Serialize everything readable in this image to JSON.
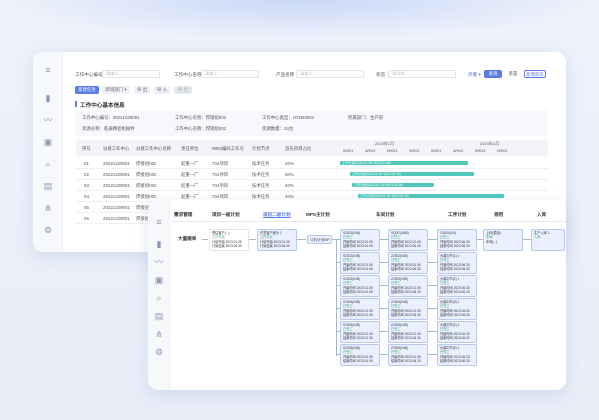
{
  "filters": {
    "wc_code_label": "工作中心编号",
    "wc_code_placeholder": "请输入",
    "wc_name_label": "工作中心名称",
    "wc_name_placeholder": "请输入",
    "product_name_label": "产品名称",
    "product_name_placeholder": "请输入",
    "status_label": "状态",
    "status_placeholder": "请选择",
    "expand_label": "折叠 ▾",
    "query_label": "查询",
    "reset_label": "重置",
    "new_label": "新增库房"
  },
  "toolbar": {
    "btn1": "新建任务",
    "btn2": "新增部门  ▾",
    "btn3": "导 出",
    "btn4": "导 入",
    "btn5": "导 出"
  },
  "basic": {
    "title": "工作中心基本信息",
    "fields": [
      "工作中心编号：20221229001",
      "工作中心名称：焊接组002",
      "工作中心类型：HYD60001",
      "所属部门：生产部",
      "资源名称：乾泰精密机械件",
      "工作中心名称：焊接组002",
      "资源数量：24台"
    ]
  },
  "table": {
    "headers": [
      "序号",
      "派接工作中心",
      "派接工作中心名称",
      "责任单位",
      "WBS编码工作号",
      "计划节点",
      "首先项目占比"
    ],
    "rows": [
      [
        "01",
        "20221229001",
        "焊接组002",
        "起重一厂",
        "704项目",
        "技术任务",
        "20%"
      ],
      [
        "02",
        "20221229001",
        "焊接组002",
        "起重一厂",
        "704项目",
        "技术任务",
        "60%"
      ],
      [
        "03",
        "20221229001",
        "焊接组002",
        "起重一厂",
        "704项目",
        "技术任务",
        "40%"
      ],
      [
        "04",
        "20221229001",
        "焊接组002",
        "起重一厂",
        "704项目",
        "技术任务",
        "40%"
      ],
      [
        "05",
        "20221229001",
        "焊接组002",
        "起重一厂",
        "704项目",
        "技术任务",
        ""
      ],
      [
        "06",
        "20221229001",
        "焊接组002",
        "起重一厂",
        "704项目",
        "技术任务",
        ""
      ]
    ],
    "months": [
      "2023年1月",
      "2023年2月"
    ],
    "weeks": [
      "WK01",
      "WK02",
      "WK03",
      "WK04",
      "WK01",
      "WK02",
      "WK03",
      "WK04"
    ],
    "bars": [
      "工作计划(2023.01.25~2023.02.08)",
      "工作计划(2023.01.25~2023.02.08)",
      "工作计划(2023.01.25~2023.02.08)",
      "工作计划(2023.01.25~2023.02.08)"
    ]
  },
  "flow": {
    "columns": [
      "需求管理",
      "项目一级计划",
      "项目二级计划",
      "MPS主计划",
      "车间计划",
      "工序计划",
      "领用",
      "入库"
    ],
    "demand": "大量跟单",
    "level1": [
      "预估客户(...)",
      "工作节点",
      "计划开始 2023.01.05",
      "计划结束 2023.06.30"
    ],
    "level2": [
      "开发客户部分 1",
      "工作节点",
      "计划开始 2023.01.05",
      "计划结束 2023.06.30"
    ],
    "mps": "订料计划MP",
    "workshop": [
      [
        "S2301(04B)",
        "已完工",
        "开始时间 2023.01.05",
        "结束时间 2023.01.05"
      ],
      [
        "S2302(04B)",
        "已完工",
        "开始时间 2023.01.05",
        "结束时间 2023.01.05"
      ],
      [
        "S2303(04B)",
        "已完工",
        "开始时间 2023.01.05",
        "结束时间 2023.01.05"
      ],
      [
        "S2304(04B)",
        "已完工",
        "开始时间 2023.01.05",
        "结束时间 2023.01.05"
      ],
      [
        "S2305(04B)",
        "已完工",
        "开始时间 2023.01.05",
        "结束时间 2023.01.05"
      ],
      [
        "S2306(04B)",
        "已完工",
        "开始时间 2023.01.05",
        "结束时间 2023.01.05"
      ]
    ],
    "process1": [
      [
        "SQ001(04B)",
        "已完工",
        "开始时间 2023.01.05",
        "结束时间 2023.06.30"
      ],
      [
        "Z2302(04B)",
        "已完工",
        "开始时间 2023.01.05",
        "结束时间 2023.06.30"
      ],
      [
        "Z2303(04B)",
        "已完工",
        "开始时间 2023.01.05",
        "结束时间 2023.06.30"
      ],
      [
        "Z2304(04B)",
        "已完工",
        "开始时间 2023.01.05",
        "结束时间 2023.06.30"
      ],
      [
        "Z2305(04B)",
        "已完工",
        "开始时间 2023.01.05",
        "结束时间 2023.06.30"
      ],
      [
        "Z2306(04B)",
        "已完工",
        "开始时间 2023.01.05",
        "结束时间 2023.06.30"
      ]
    ],
    "process2": [
      [
        "1J0001(04)",
        "已完工",
        "开始时间 2023.06.30",
        "结束时间 2023.06.30"
      ],
      [
        "大端中节(1) 1",
        "已完工",
        "开始时间 2023.06.30",
        "结束时间 2023.06.30"
      ],
      [
        "大端中节(2) 1",
        "已完工",
        "开始时间 2023.06.30",
        "结束时间 2023.06.30"
      ],
      [
        "大端中节(3) 1",
        "已完工",
        "开始时间 2023.06.30",
        "结束时间 2023.06.30"
      ],
      [
        "大端中节(4) 1",
        "已完工",
        "开始时间 2023.06.30",
        "结束时间 2023.06.30"
      ],
      [
        "大端中节(5) 1",
        "已完工",
        "开始时间 2023.06.30",
        "结束时间 2023.06.30"
      ]
    ],
    "pick": [
      "上料(模拟)",
      "车间-",
      "车间(...)"
    ],
    "store": [
      "生产入库 1",
      "入库",
      "..."
    ]
  },
  "colors": {
    "accent": "#5b7be6",
    "bar": "#4fc8b9",
    "node_bg": "#eaf0ff"
  }
}
